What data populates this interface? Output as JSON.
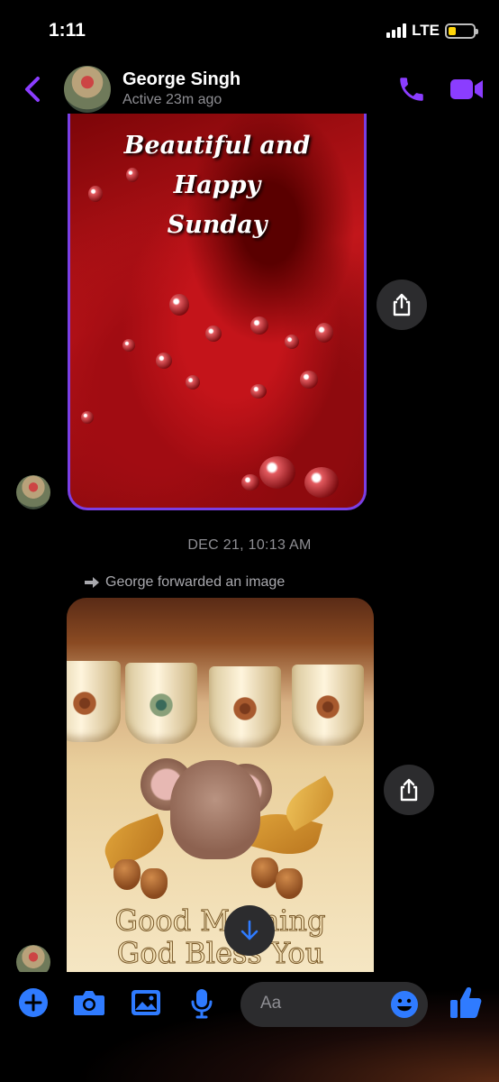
{
  "status_bar": {
    "time": "1:11",
    "network": "LTE"
  },
  "header": {
    "name": "George Singh",
    "active_status": "Active 23m ago"
  },
  "messages": {
    "first_image_text": [
      "Beautiful and",
      "Happy",
      "Sunday"
    ],
    "timestamp": "DEC 21, 10:13 AM",
    "forwarded_note": "George forwarded an image",
    "second_image_text": [
      "Good Morning",
      "God Bless You"
    ]
  },
  "composer": {
    "placeholder": "Aa"
  },
  "colors": {
    "accent": "#8b3dff",
    "messenger_blue": "#2f7bff",
    "bubble_border": "#7a3fe4"
  },
  "icons": [
    "back-icon",
    "phone-icon",
    "video-icon",
    "share-icon",
    "forward-arrow-icon",
    "scroll-down-icon",
    "plus-icon",
    "camera-icon",
    "image-icon",
    "mic-icon",
    "emoji-icon",
    "thumbs-up-icon"
  ]
}
